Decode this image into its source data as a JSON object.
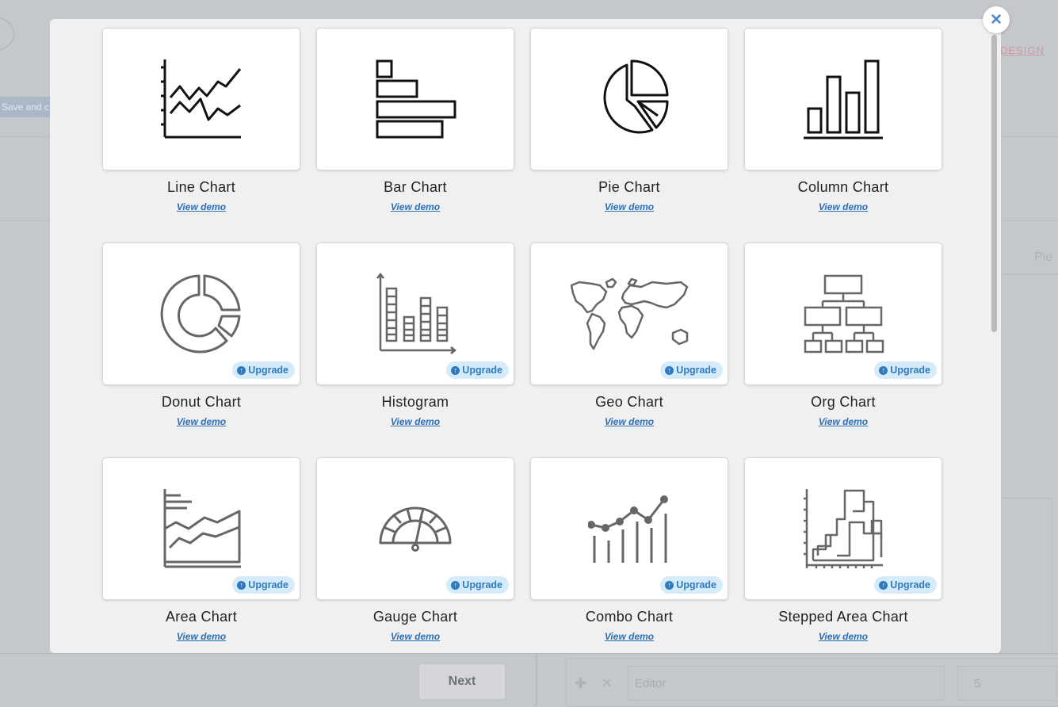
{
  "background": {
    "save_label": "Save and c",
    "design_label": "DESIGN",
    "pie_label": "Pie",
    "next_label": "Next",
    "editor_placeholder": "Editor",
    "number_value": "5"
  },
  "modal": {
    "close_icon": "×",
    "charts": [
      {
        "title": "Line Chart",
        "demo": "View demo",
        "icon": "line-chart-icon",
        "upgrade": false
      },
      {
        "title": "Bar Chart",
        "demo": "View demo",
        "icon": "bar-chart-icon",
        "upgrade": false
      },
      {
        "title": "Pie Chart",
        "demo": "View demo",
        "icon": "pie-chart-icon",
        "upgrade": false
      },
      {
        "title": "Column Chart",
        "demo": "View demo",
        "icon": "column-chart-icon",
        "upgrade": false
      },
      {
        "title": "Donut Chart",
        "demo": "View demo",
        "icon": "donut-chart-icon",
        "upgrade": true
      },
      {
        "title": "Histogram",
        "demo": "View demo",
        "icon": "histogram-icon",
        "upgrade": true
      },
      {
        "title": "Geo Chart",
        "demo": "View demo",
        "icon": "world-map-icon",
        "upgrade": true
      },
      {
        "title": "Org Chart",
        "demo": "View demo",
        "icon": "org-chart-icon",
        "upgrade": true
      },
      {
        "title": "Area Chart",
        "demo": "View demo",
        "icon": "area-chart-icon",
        "upgrade": true
      },
      {
        "title": "Gauge Chart",
        "demo": "View demo",
        "icon": "gauge-icon",
        "upgrade": true
      },
      {
        "title": "Combo Chart",
        "demo": "View demo",
        "icon": "combo-chart-icon",
        "upgrade": true
      },
      {
        "title": "Stepped Area Chart",
        "demo": "View demo",
        "icon": "stepped-area-icon",
        "upgrade": true
      }
    ],
    "upgrade_label": "Upgrade"
  },
  "colors": {
    "link": "#2b6fb8",
    "upgrade_bg": "#d6ebf9",
    "upgrade_text": "#2e7ac0",
    "close": "#4a86c8"
  }
}
